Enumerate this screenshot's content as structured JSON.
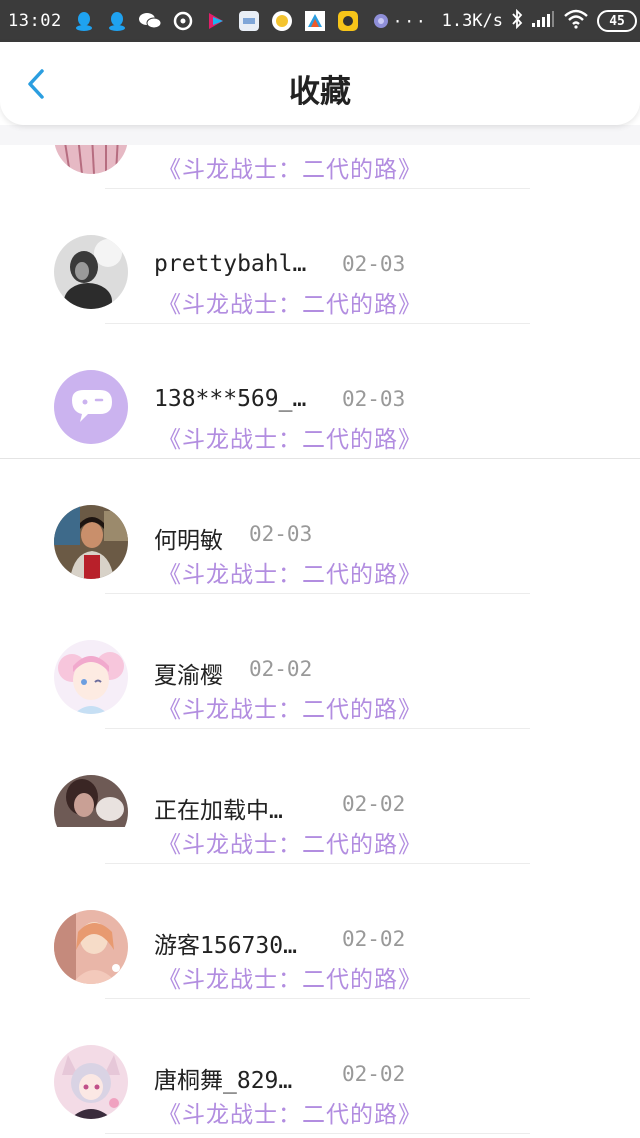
{
  "status_bar": {
    "time": "13:02",
    "dots": "···",
    "network_speed": "1.3K/s",
    "battery": "45",
    "icons": [
      "qq-icon",
      "qq-icon",
      "wechat-icon",
      "music-icon",
      "youku-icon",
      "app-icon",
      "app-icon",
      "app-icon",
      "app-icon",
      "app-icon",
      "bluetooth-icon",
      "signal-icon",
      "wifi-icon"
    ]
  },
  "header": {
    "title": "收藏",
    "back_icon": "chevron-left-icon"
  },
  "colors": {
    "accent": "#2b9ee0",
    "title_purple": "#b28de0",
    "date_gray": "#999999"
  },
  "items": [
    {
      "name": "",
      "date": "",
      "title": "《斗龙战士：二代的路》"
    },
    {
      "name": "prettybahl…",
      "date": "02-03",
      "title": "《斗龙战士：二代的路》"
    },
    {
      "name": "138***569_…",
      "date": "02-03",
      "title": "《斗龙战士：二代的路》"
    },
    {
      "name": "何明敏",
      "date": "02-03",
      "title": "《斗龙战士：二代的路》"
    },
    {
      "name": "夏渝樱",
      "date": "02-02",
      "title": "《斗龙战士：二代的路》"
    },
    {
      "name": "正在加载中…",
      "date": "02-02",
      "title": "《斗龙战士：二代的路》"
    },
    {
      "name": "游客156730…",
      "date": "02-02",
      "title": "《斗龙战士：二代的路》"
    },
    {
      "name": "唐桐舞_829…",
      "date": "02-02",
      "title": "《斗龙战士：二代的路》"
    }
  ]
}
